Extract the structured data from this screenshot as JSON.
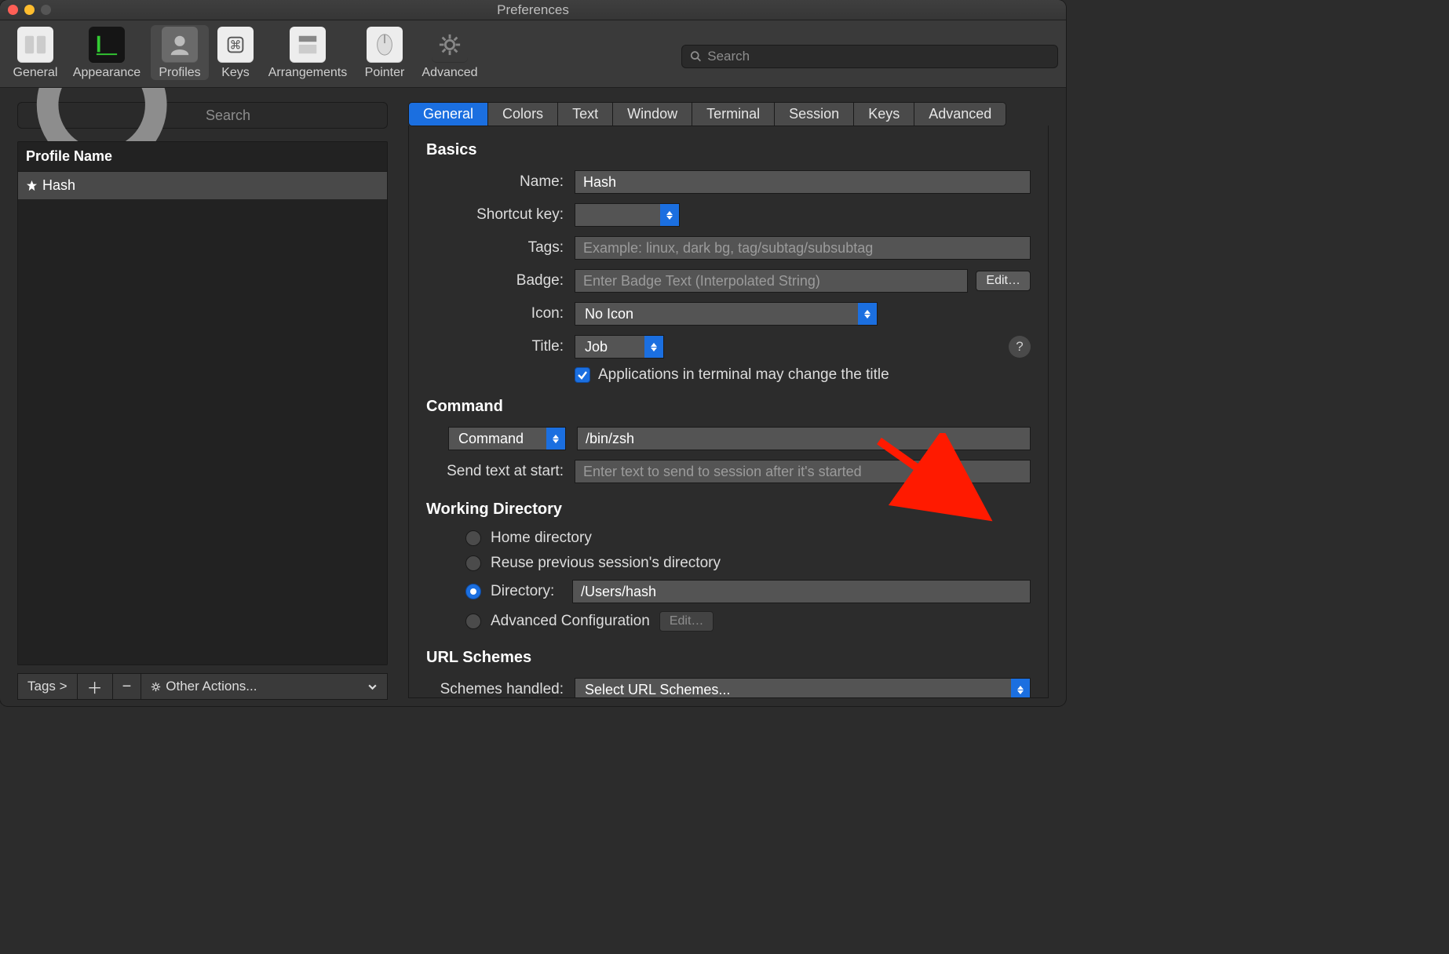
{
  "window": {
    "title": "Preferences"
  },
  "toolbar": {
    "general": "General",
    "appearance": "Appearance",
    "profiles": "Profiles",
    "keys": "Keys",
    "arrangements": "Arrangements",
    "pointer": "Pointer",
    "advanced": "Advanced",
    "search_placeholder": "Search"
  },
  "sidebar": {
    "search_placeholder": "Search",
    "header": "Profile Name",
    "profile": "Hash",
    "tags_button": "Tags >",
    "other_actions": "Other Actions..."
  },
  "tabs": {
    "general": "General",
    "colors": "Colors",
    "text": "Text",
    "window": "Window",
    "terminal": "Terminal",
    "session": "Session",
    "keys": "Keys",
    "advanced": "Advanced"
  },
  "basics": {
    "heading": "Basics",
    "name_label": "Name:",
    "name_value": "Hash",
    "shortcut_label": "Shortcut key:",
    "shortcut_value": "",
    "tags_label": "Tags:",
    "tags_placeholder": "Example: linux, dark bg, tag/subtag/subsubtag",
    "badge_label": "Badge:",
    "badge_placeholder": "Enter Badge Text (Interpolated String)",
    "edit": "Edit…",
    "icon_label": "Icon:",
    "icon_value": "No Icon",
    "title_label": "Title:",
    "title_value": "Job",
    "apps_change": "Applications in terminal may change the title"
  },
  "command": {
    "heading": "Command",
    "mode": "Command",
    "value": "/bin/zsh",
    "send_label": "Send text at start:",
    "send_placeholder": "Enter text to send to session after it's started"
  },
  "wd": {
    "heading": "Working Directory",
    "home": "Home directory",
    "reuse": "Reuse previous session's directory",
    "directory_label": "Directory:",
    "directory_value": "/Users/hash",
    "advanced": "Advanced Configuration",
    "edit": "Edit…"
  },
  "url": {
    "heading": "URL Schemes",
    "label": "Schemes handled:",
    "value": "Select URL Schemes..."
  }
}
